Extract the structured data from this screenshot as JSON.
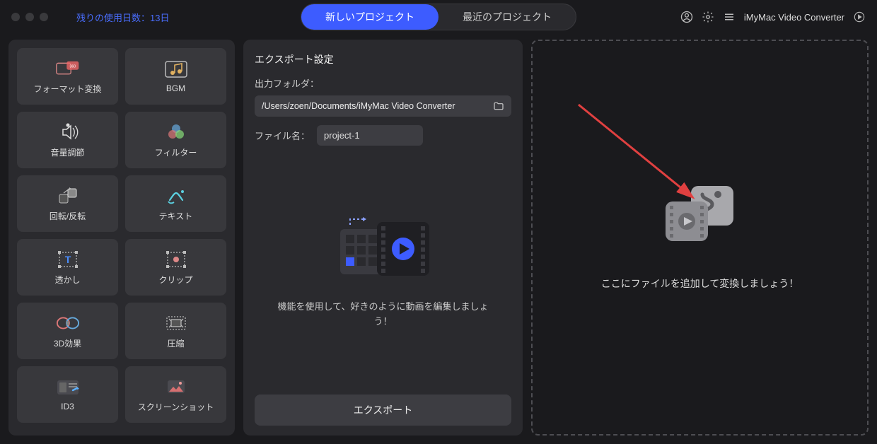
{
  "titlebar": {
    "trial_label": "残りの使用日数：13日",
    "tabs": {
      "new_project": "新しいプロジェクト",
      "recent_projects": "最近のプロジェクト"
    },
    "app_name": "iMyMac Video Converter"
  },
  "sidebar": {
    "tools": [
      {
        "id": "format-convert",
        "label": "フォーマット変換"
      },
      {
        "id": "bgm",
        "label": "BGM"
      },
      {
        "id": "volume-adjust",
        "label": "音量調節"
      },
      {
        "id": "filter",
        "label": "フィルター"
      },
      {
        "id": "rotate-flip",
        "label": "回転/反転"
      },
      {
        "id": "text",
        "label": "テキスト"
      },
      {
        "id": "watermark",
        "label": "透かし"
      },
      {
        "id": "clip",
        "label": "クリップ"
      },
      {
        "id": "3d-effect",
        "label": "3D効果"
      },
      {
        "id": "compress",
        "label": "圧縮"
      },
      {
        "id": "id3",
        "label": "ID3"
      },
      {
        "id": "screenshot",
        "label": "スクリーンショット"
      }
    ]
  },
  "export": {
    "title": "エクスポート設定",
    "folder_label": "出力フォルダ：",
    "folder_path": "/Users/zoen/Documents/iMyMac Video Converter",
    "filename_label": "ファイル名：",
    "filename_value": "project-1",
    "hint": "機能を使用して、好きのように動画を編集しましょう！",
    "button": "エクスポート"
  },
  "dropzone": {
    "hint": "ここにファイルを追加して変換しましょう！"
  },
  "colors": {
    "accent": "#3d5cff",
    "link": "#4a6eff",
    "panel": "#2a2a2e",
    "tile": "#38383c",
    "arrow": "#e04040"
  }
}
